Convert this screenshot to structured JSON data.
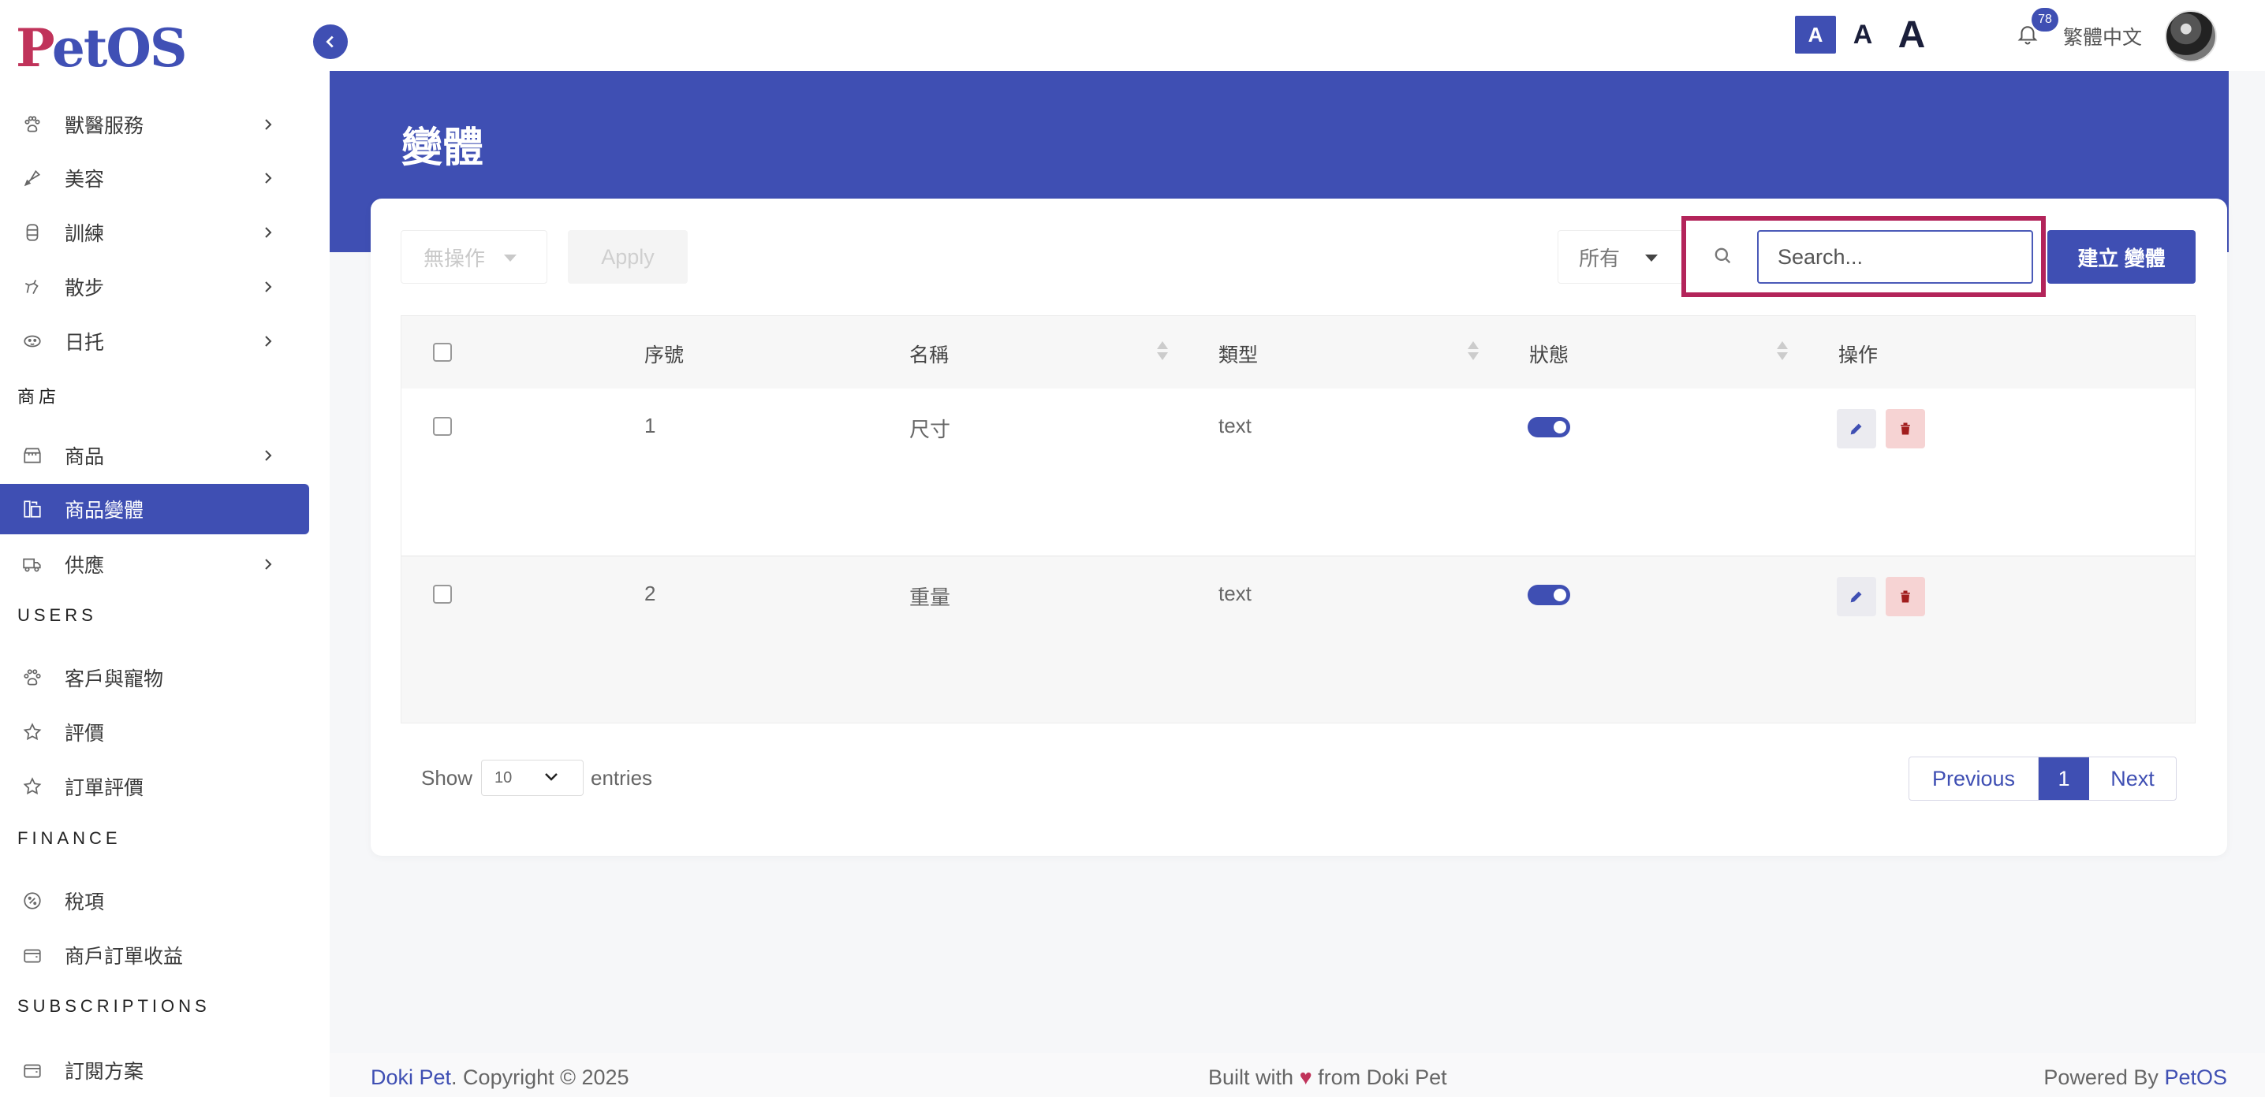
{
  "app": {
    "logo_p": "P",
    "logo_rest": "etOS"
  },
  "topbar": {
    "font_small": "A",
    "font_medium": "A",
    "font_large": "A",
    "notification_count": "78",
    "language": "繁體中文"
  },
  "sidebar": {
    "items_top": [
      {
        "label": "獸醫服務",
        "icon": "paw-medical-icon"
      },
      {
        "label": "美容",
        "icon": "brush-icon"
      },
      {
        "label": "訓練",
        "icon": "training-icon"
      },
      {
        "label": "散步",
        "icon": "walk-icon"
      },
      {
        "label": "日托",
        "icon": "daycare-icon"
      }
    ],
    "section_shop": "商店",
    "items_shop": [
      {
        "label": "商品",
        "icon": "store-icon"
      },
      {
        "label": "商品變體",
        "icon": "variant-icon"
      },
      {
        "label": "供應",
        "icon": "truck-icon"
      }
    ],
    "section_users": "USERS",
    "items_users": [
      {
        "label": "客戶與寵物",
        "icon": "paw-icon"
      },
      {
        "label": "評價",
        "icon": "star-icon"
      },
      {
        "label": "訂單評價",
        "icon": "star-icon"
      }
    ],
    "section_finance": "FINANCE",
    "items_finance": [
      {
        "label": "稅項",
        "icon": "tax-icon"
      },
      {
        "label": "商戶訂單收益",
        "icon": "wallet-icon"
      }
    ],
    "section_subscriptions": "SUBSCRIPTIONS",
    "items_subscriptions": [
      {
        "label": "訂閱方案",
        "icon": "wallet-icon"
      }
    ]
  },
  "page": {
    "title": "變體"
  },
  "toolbar": {
    "bulk_action": "無操作",
    "apply_label": "Apply",
    "filter_value": "所有",
    "search_placeholder": "Search...",
    "create_label": "建立 變體"
  },
  "table": {
    "columns": [
      "序號",
      "名稱",
      "類型",
      "狀態",
      "操作"
    ],
    "rows": [
      {
        "index": "1",
        "name": "尺寸",
        "type": "text",
        "status": true
      },
      {
        "index": "2",
        "name": "重量",
        "type": "text",
        "status": true
      }
    ]
  },
  "pagination": {
    "show_label": "Show",
    "page_length": "10",
    "entries_label": "entries",
    "previous": "Previous",
    "current": "1",
    "next": "Next"
  },
  "footer": {
    "brand_left": "Doki Pet",
    "copyright": ". Copyright © 2025",
    "built_prefix": "Built with",
    "heart": "♥",
    "built_suffix": "from Doki Pet",
    "powered_prefix": "Powered By",
    "powered_brand": "PetOS"
  },
  "colors": {
    "primary": "#3f4fb3",
    "logo_red": "#c0335a",
    "highlight_frame": "#b3245a",
    "delete_bg": "#f6d3d3"
  }
}
